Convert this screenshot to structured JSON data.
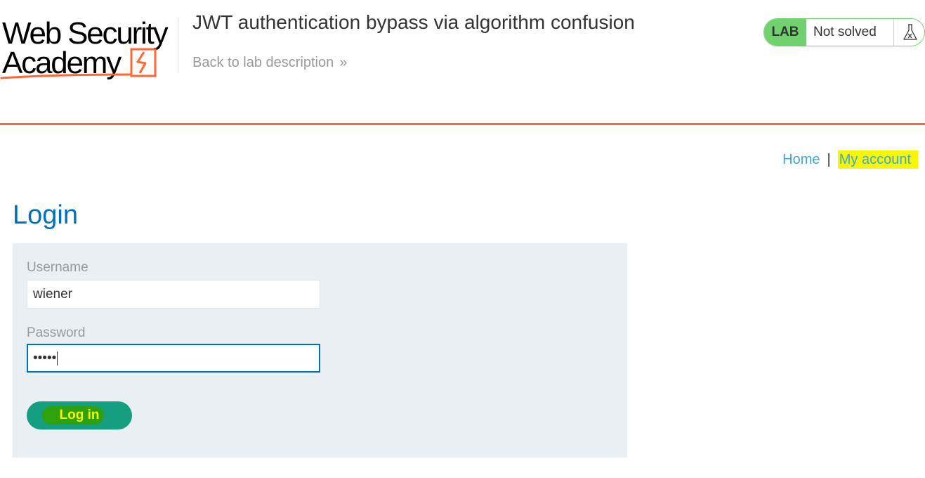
{
  "header": {
    "logo_line1": "Web Security",
    "logo_line2": "Academy",
    "lab_title": "JWT authentication bypass via algorithm confusion",
    "back_link": "Back to lab description",
    "status": {
      "lab_label": "LAB",
      "status_text": "Not solved",
      "icon": "flask-icon"
    }
  },
  "nav": {
    "home": "Home",
    "separator": "|",
    "my_account": "My account"
  },
  "main": {
    "title": "Login",
    "form": {
      "username_label": "Username",
      "username_value": "wiener",
      "password_label": "Password",
      "password_value": "•••••",
      "submit_label": "Log in"
    }
  },
  "colors": {
    "brand_orange": "#ff6633",
    "lab_green": "#70d16d",
    "link_blue": "#3ea6d9",
    "title_blue": "#0071bc",
    "button_teal": "#159e7f",
    "highlight_yellow": "#f7f700"
  }
}
